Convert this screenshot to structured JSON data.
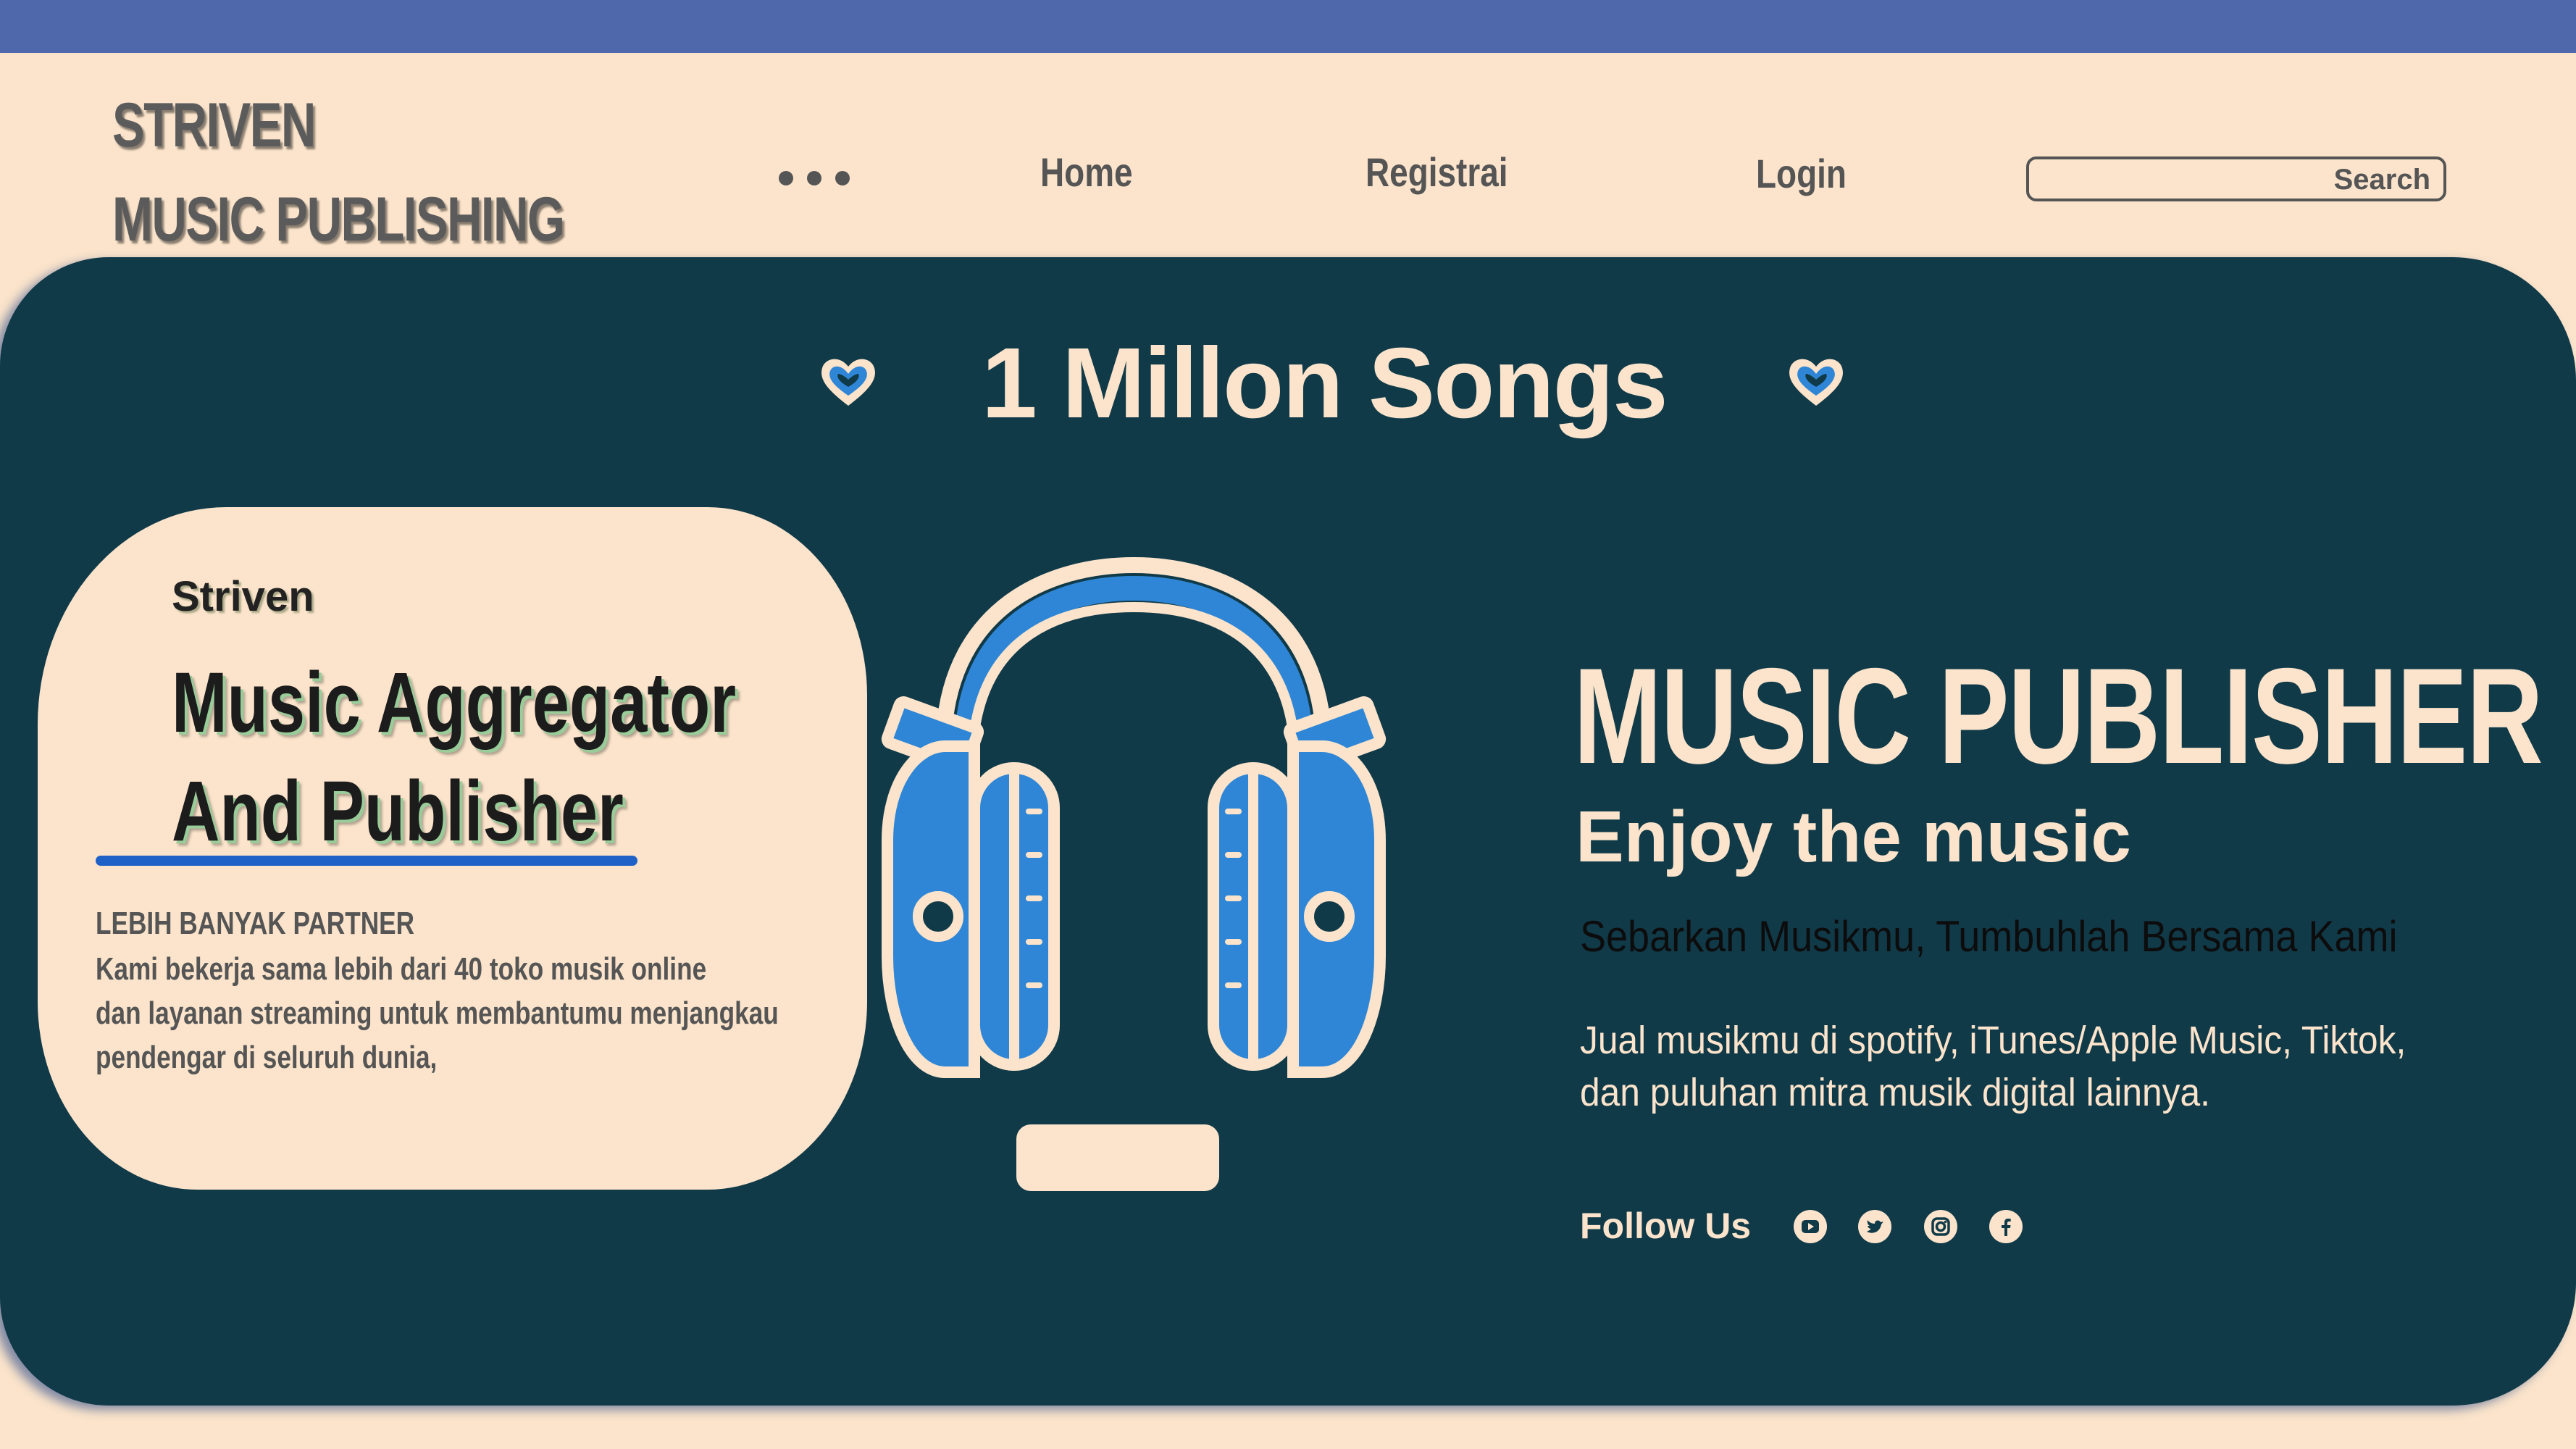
{
  "brand": {
    "line1": "STRIVEN",
    "line2": "MUSIC PUBLISHING"
  },
  "nav": {
    "menu_icon": "more-dots-icon",
    "items": [
      {
        "label": "Home"
      },
      {
        "label": "Registrai"
      },
      {
        "label": "Login"
      }
    ],
    "search_placeholder": "Search"
  },
  "hero": {
    "headline": "1 Millon Songs",
    "heart_icon": "heart-icon",
    "card": {
      "brand": "Striven",
      "title_line1": "Music Aggregator",
      "title_line2": "And Publisher",
      "subheading": "LEBIH BANYAK PARTNER",
      "body_lines": [
        "Kami bekerja sama lebih dari 40 toko musik online",
        "dan layanan streaming untuk membantumu menjangkau",
        "pendengar di seluruh dunia,"
      ]
    },
    "illustration": "headphones-icon",
    "title": "MUSIC PUBLISHER",
    "subtitle": "Enjoy the music",
    "tagline": "Sebarkan Musikmu,  Tumbuhlah Bersama Kami",
    "description_lines": [
      "Jual musikmu di spotify, iTunes/Apple Music, Tiktok,",
      "dan puluhan mitra musik digital lainnya."
    ],
    "follow_label": "Follow Us",
    "social_icons": [
      "youtube-icon",
      "twitter-icon",
      "instagram-icon",
      "facebook-icon"
    ]
  },
  "colors": {
    "top_bar": "#4f67ab",
    "background": "#fbe4cb",
    "panel": "#113a49",
    "accent_blue": "#2f86d6",
    "underline": "#2061c8"
  }
}
